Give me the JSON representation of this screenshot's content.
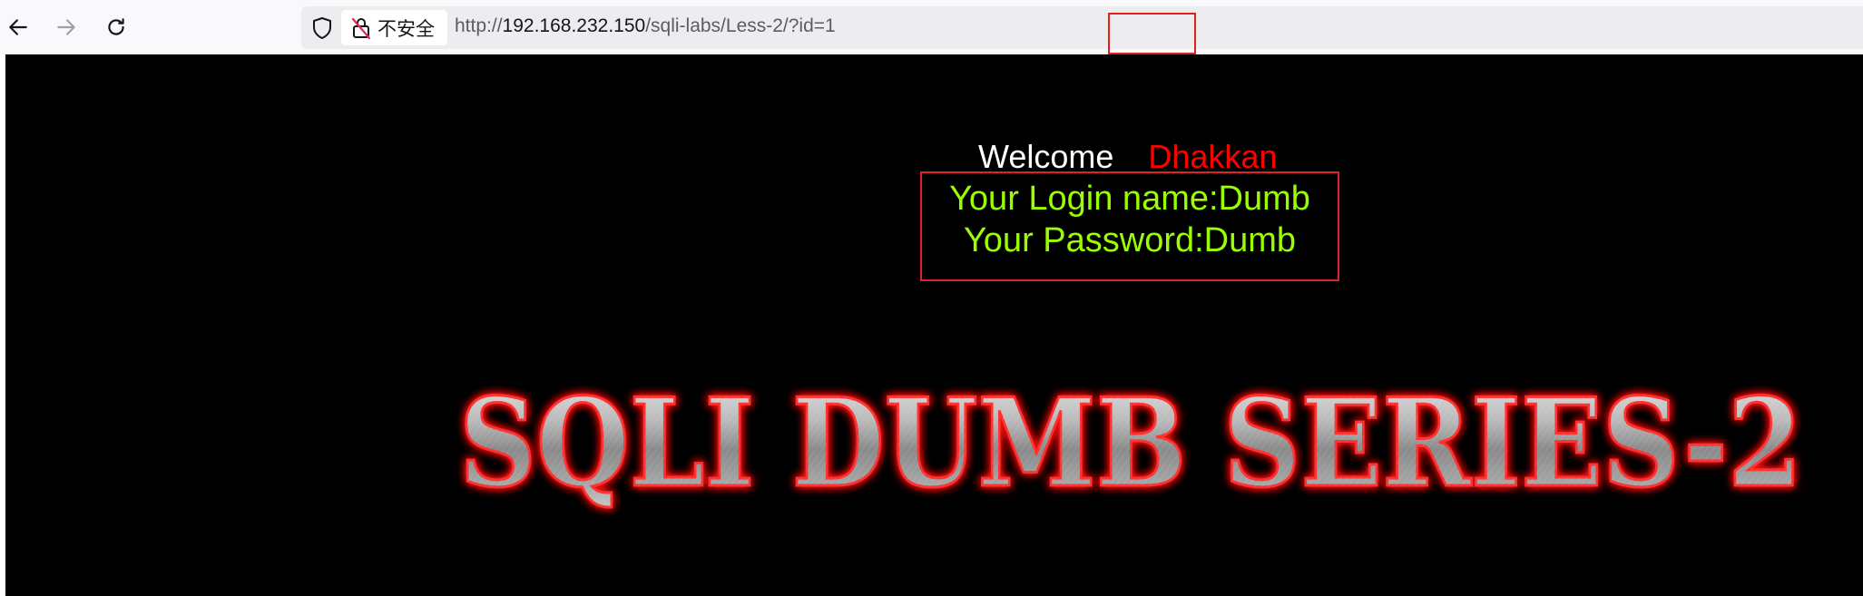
{
  "browser": {
    "nav": {
      "back_icon": "arrow-left-icon",
      "forward_icon": "arrow-right-icon",
      "reload_icon": "reload-icon"
    },
    "address_bar": {
      "tracking_icon": "shield-icon",
      "security_icon": "insecure-lock-icon",
      "security_label": "不安全",
      "url_prefix": "http://",
      "url_host": "192.168.232.150",
      "url_path": "/sqli-labs/Less-2/",
      "url_query": "?id=1",
      "highlight_color": "#e02020"
    }
  },
  "page": {
    "background": "#000000",
    "welcome_label": "Welcome",
    "welcome_name": "Dhakkan",
    "login_line": "Your Login name:Dumb",
    "password_line": "Your Password:Dumb",
    "result_color": "#99ff00",
    "title_image_text": "SQLI DUMB SERIES-2"
  }
}
